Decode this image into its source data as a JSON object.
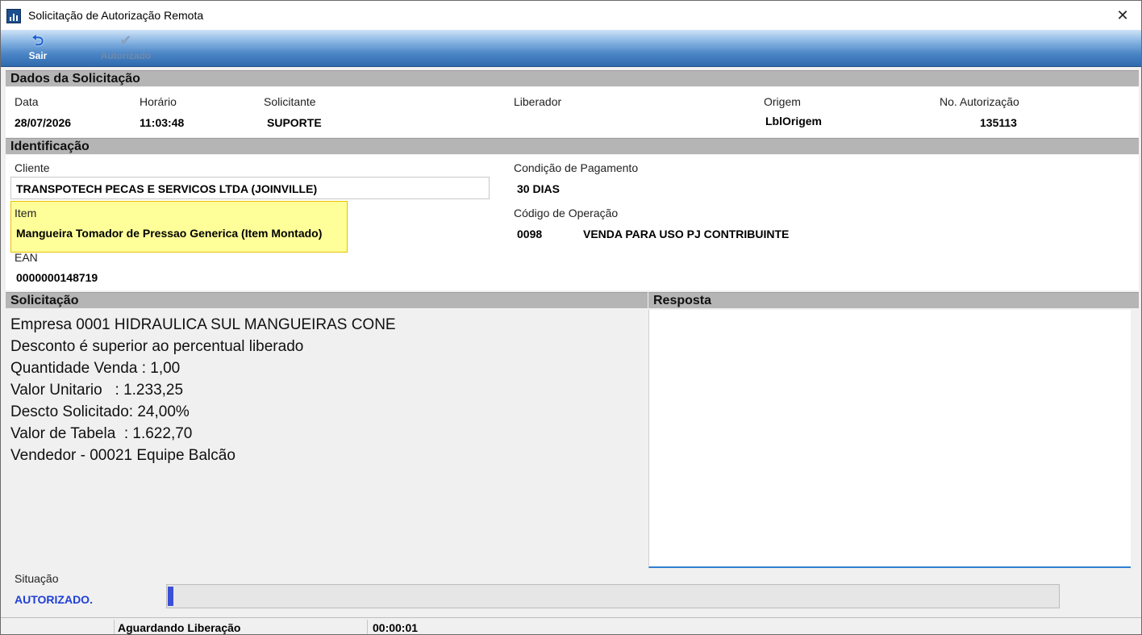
{
  "window": {
    "title": "Solicitação de Autorização Remota",
    "close_glyph": "✕"
  },
  "toolbar": {
    "sair": {
      "label": "Sair",
      "icon": "undo-arrow-icon",
      "glyph": "⮌"
    },
    "autorizado": {
      "label": "Autorizado",
      "icon": "checkmark-icon",
      "glyph": "✔",
      "enabled": false
    }
  },
  "dados": {
    "header": "Dados da Solicitação",
    "data_label": "Data",
    "data_value": "28/07/2026",
    "horario_label": "Horário",
    "horario_value": "11:03:48",
    "solicitante_label": "Solicitante",
    "solicitante_value": "SUPORTE",
    "liberador_label": "Liberador",
    "origem_label": "Origem",
    "origem_value": "LblOrigem",
    "autorizacao_label": "No. Autorização",
    "autorizacao_value": "135113"
  },
  "identificacao": {
    "header": "Identificação",
    "cliente_label": "Cliente",
    "cliente_value": "TRANSPOTECH PECAS E SERVICOS LTDA (JOINVILLE)",
    "item_label": "Item",
    "item_value": "Mangueira Tomador de Pressao Generica (Item Montado)",
    "ean_label": "EAN",
    "ean_value": "0000000148719",
    "condicao_label": "Condição de Pagamento",
    "condicao_value": "30 DIAS",
    "operacao_label": "Código de Operação",
    "operacao_code": "0098",
    "operacao_desc": "VENDA PARA USO PJ CONTRIBUINTE"
  },
  "solicitacao": {
    "header": "Solicitação",
    "lines": [
      "Empresa 0001 HIDRAULICA SUL MANGUEIRAS CONE",
      "Desconto é superior ao percentual liberado",
      "Quantidade Venda : 1,00",
      "Valor Unitario   : 1.233,25",
      "Descto Solicitado: 24,00%",
      "Valor de Tabela  : 1.622,70",
      "Vendedor - 00021 Equipe Balcão"
    ]
  },
  "resposta": {
    "header": "Resposta",
    "text": ""
  },
  "situacao": {
    "label": "Situação",
    "value": "AUTORIZADO.",
    "value_color": "#1f3fd6",
    "progress_fraction": 0.006
  },
  "statusbar": {
    "status": "Aguardando Liberação",
    "timer": "00:00:01"
  },
  "colors": {
    "accent_toolbar": "#2f6aae",
    "header_gray": "#b5b5b5",
    "item_highlight": "#ffff99"
  }
}
